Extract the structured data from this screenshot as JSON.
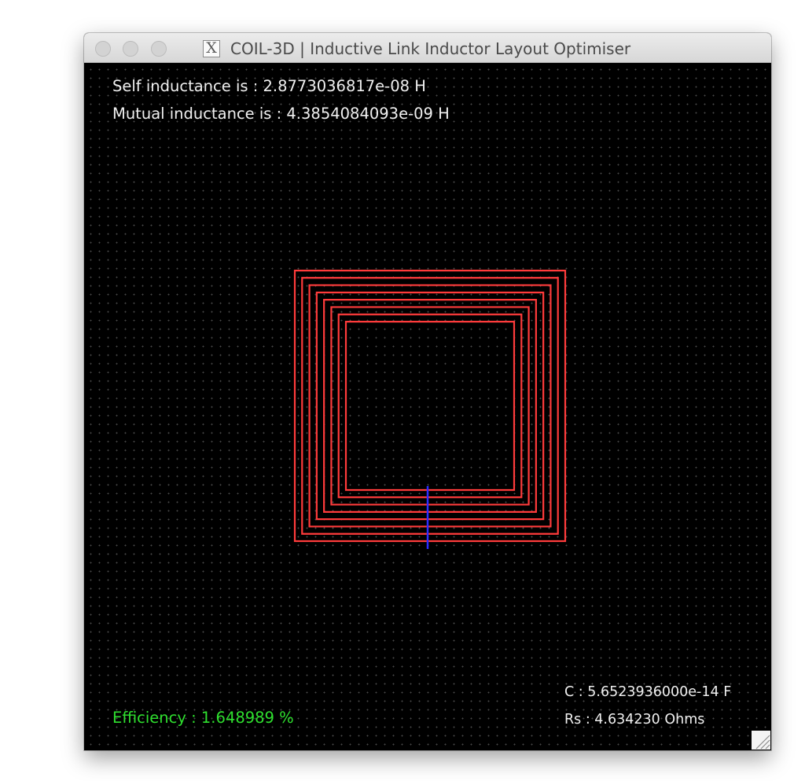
{
  "window": {
    "title": "COIL-3D | Inductive Link Inductor Layout Optimiser",
    "app_icon": "x11-icon"
  },
  "readouts": {
    "self_inductance": "Self inductance is : 2.8773036817e-08 H",
    "mutual_inductance": "Mutual inductance is : 4.3854084093e-09 H",
    "capacitance": "C : 5.6523936000e-14 F",
    "series_resistance": "Rs : 4.634230 Ohms",
    "efficiency": "Efficiency : 1.648989 %"
  },
  "coil": {
    "turns": 8,
    "trace_color": "#ff3b3b",
    "via_color": "#2b2bff"
  },
  "colors": {
    "canvas_background": "#000000",
    "text": "#f0f0f0",
    "efficiency_text": "#2fe02f"
  }
}
